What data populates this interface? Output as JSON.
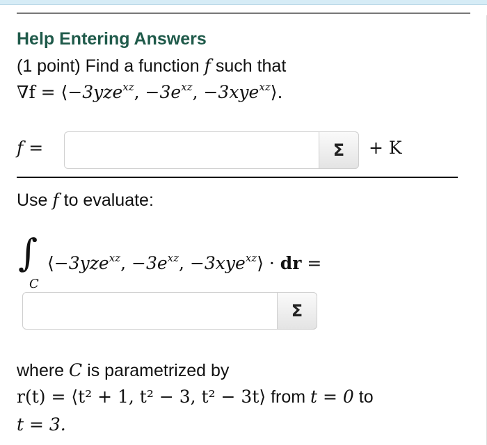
{
  "header": {
    "help_link": "Help Entering Answers"
  },
  "problem": {
    "points_and_prompt": "(1 point) Find a function",
    "f_symbol": "f",
    "such_that": "such that",
    "gradient_line": {
      "nabla_f": "∇f = ⟨",
      "c1": "−3yze",
      "e1": "xz",
      "sep1": ", ",
      "c2": "−3e",
      "e2": "xz",
      "sep2": ", ",
      "c3": "−3xye",
      "e3": "xz",
      "close": "⟩."
    },
    "f_eq_label": "f =",
    "plus_k": "+ K",
    "use_text_a": "Use",
    "use_f": "f",
    "use_text_b": "to evaluate:",
    "integral_symbol": "∫",
    "integral_sub": "C",
    "integrand": {
      "open": "⟨",
      "c1": "−3yze",
      "e1": "xz",
      "sep1": ", ",
      "c2": "−3e",
      "e2": "xz",
      "sep2": ", ",
      "c3": "−3xye",
      "e3": "xz",
      "close": "⟩ · ",
      "dr": "dr",
      "eq": " ="
    },
    "where_a": "where",
    "where_c": "C",
    "where_b": "is parametrized by",
    "param_math": "r(t) = ⟨t² + 1, t² − 3, t² − 3t⟩",
    "param_from": "from",
    "param_t0": "t = 0",
    "param_to": "to",
    "param_t3": "t = 3."
  },
  "inputs": {
    "answer_f": {
      "value": "",
      "placeholder": ""
    },
    "answer_integral": {
      "value": "",
      "placeholder": ""
    },
    "sigma_label": "Σ"
  }
}
